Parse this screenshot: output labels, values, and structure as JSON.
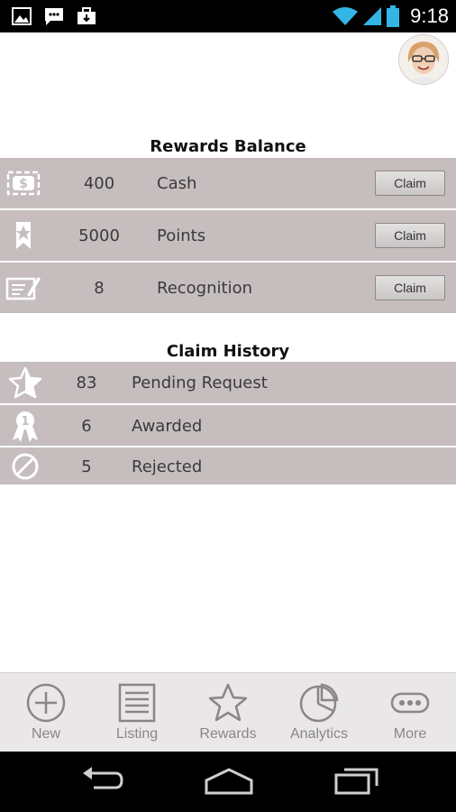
{
  "status_bar": {
    "time": "9:18",
    "icons": [
      "image-icon",
      "chat-icon",
      "briefcase-icon",
      "wifi-icon",
      "signal-icon",
      "battery-icon"
    ]
  },
  "rewards_balance": {
    "title": "Rewards Balance",
    "items": [
      {
        "icon": "cash-icon",
        "value": "400",
        "label": "Cash",
        "button": "Claim"
      },
      {
        "icon": "points-badge-icon",
        "value": "5000",
        "label": "Points",
        "button": "Claim"
      },
      {
        "icon": "certificate-icon",
        "value": "8",
        "label": "Recognition",
        "button": "Claim"
      }
    ]
  },
  "claim_history": {
    "title": "Claim History",
    "items": [
      {
        "icon": "star-icon",
        "value": "83",
        "label": "Pending Request"
      },
      {
        "icon": "medal-icon",
        "value": "6",
        "label": "Awarded"
      },
      {
        "icon": "rejected-icon",
        "value": "5",
        "label": "Rejected"
      }
    ]
  },
  "tabs": [
    {
      "label": "New",
      "icon": "plus-circle-icon"
    },
    {
      "label": "Listing",
      "icon": "list-icon"
    },
    {
      "label": "Rewards",
      "icon": "star-outline-icon"
    },
    {
      "label": "Analytics",
      "icon": "pie-chart-icon"
    },
    {
      "label": "More",
      "icon": "more-icon"
    }
  ],
  "nav": [
    "back-icon",
    "home-icon",
    "recent-apps-icon"
  ],
  "colors": {
    "row_bg": "#c6bebe",
    "tab_bg": "#e9e7e7",
    "wifi": "#33b5e5"
  }
}
